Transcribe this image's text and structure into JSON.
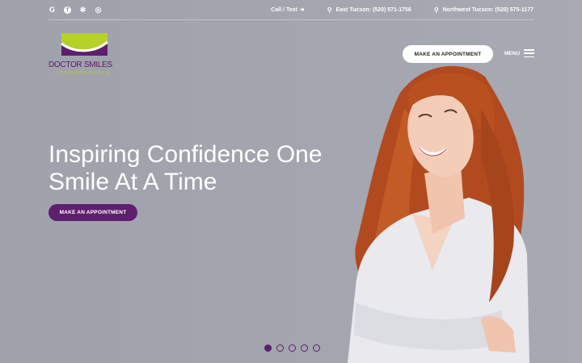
{
  "topbar": {
    "social": [
      {
        "name": "google-icon",
        "glyph": "G"
      },
      {
        "name": "facebook-icon",
        "glyph": "f"
      },
      {
        "name": "yelp-icon",
        "glyph": "✻"
      },
      {
        "name": "instagram-icon",
        "glyph": "◎"
      }
    ],
    "call_label": "Call / Text",
    "east_label": "East Tucson: (520) 571-1756",
    "northwest_label": "Northwest Tucson: (520) 575-1177"
  },
  "logo": {
    "name": "DOCTOR SMILES",
    "tagline": "orthodontics"
  },
  "header": {
    "appointment_label": "MAKE AN APPOINTMENT",
    "menu_label": "MENU"
  },
  "hero": {
    "headline": "Inspiring Confidence One Smile At A Time",
    "cta_label": "MAKE AN APPOINTMENT",
    "slides_total": 5,
    "active_slide": 1
  },
  "colors": {
    "brand_purple": "#5e1f6e",
    "brand_green": "#b6d12a",
    "hero_gray": "#a0a2ac"
  }
}
